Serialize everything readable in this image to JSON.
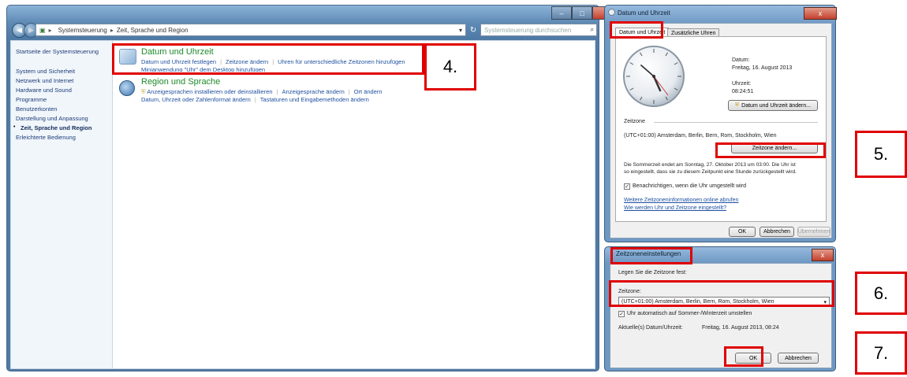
{
  "control_panel": {
    "address": [
      "Systemsteuerung",
      "Zeit, Sprache und Region"
    ],
    "search_placeholder": "Systemsteuerung durchsuchen",
    "sidebar": [
      {
        "label": "Startseite der Systemsteuerung",
        "active": false
      },
      {
        "label": "System und Sicherheit",
        "active": false
      },
      {
        "label": "Netzwerk und Internet",
        "active": false
      },
      {
        "label": "Hardware und Sound",
        "active": false
      },
      {
        "label": "Programme",
        "active": false
      },
      {
        "label": "Benutzerkonten",
        "active": false
      },
      {
        "label": "Darstellung und Anpassung",
        "active": false
      },
      {
        "label": "Zeit, Sprache und Region",
        "active": true
      },
      {
        "label": "Erleichterte Bedienung",
        "active": false
      }
    ],
    "categories": {
      "datetime": {
        "title": "Datum und Uhrzeit",
        "links": [
          "Datum und Uhrzeit festlegen",
          "Zeitzone ändern",
          "Uhren für unterschiedliche Zeitzonen hinzufügen"
        ],
        "link2": "Minianwendung \"Uhr\" dem Desktop hinzufügen"
      },
      "region": {
        "title": "Region und Sprache",
        "links": [
          "Anzeigesprachen installieren oder deinstallieren",
          "Anzeigesprache ändern",
          "Ort ändern"
        ],
        "links2": [
          "Datum, Uhrzeit oder Zahlenformat ändern",
          "Tastaturen und Eingabemethoden ändern"
        ]
      }
    }
  },
  "datetime_dialog": {
    "title": "Datum und Uhrzeit",
    "close": "x",
    "tabs": [
      "Datum und Uhrzeit",
      "Zusätzliche Uhren"
    ],
    "date_label": "Datum:",
    "date_value": "Freitag, 16. August 2013",
    "time_label": "Uhrzeit:",
    "time_value": "08:24:51",
    "change_datetime_button": "Datum und Uhrzeit ändern...",
    "timezone_heading": "Zeitzone",
    "timezone_value": "(UTC+01:00) Amsterdam, Berlin, Bern, Rom, Stockholm, Wien",
    "change_timezone_button": "Zeitzone ändern...",
    "dst_line1": "Die Sommerzeit endet am Sonntag, 27. Oktober 2013 um 03:00. Die Uhr ist",
    "dst_line2": "so eingestellt, dass sie zu diesem Zeitpunkt eine Stunde zurückgestellt wird.",
    "notify_label": "Benachrichtigen, wenn die Uhr umgestellt wird",
    "link_more_info": "Weitere Zeitzoneninformationen online abrufen",
    "link_how_set": "Wie werden Uhr und Zeitzone eingestellt?",
    "ok": "OK",
    "cancel": "Abbrechen",
    "apply": "Übernehmen"
  },
  "timezone_dialog": {
    "title": "Zeitzoneneinstellungen",
    "close": "x",
    "instruction": "Legen Sie die Zeitzone fest:",
    "timezone_label": "Zeitzone:",
    "timezone_selected": "(UTC+01:00) Amsterdam, Berlin, Bern, Rom, Stockholm, Wien",
    "dst_checkbox_label": "Uhr automatisch auf Sommer-/Winterzeit umstellen",
    "current_label": "Aktuelle(s) Datum/Uhrzeit:",
    "current_value": "Freitag, 16. August 2013, 08:24",
    "ok": "OK",
    "cancel": "Abbrechen"
  },
  "steps": [
    "4.",
    "5.",
    "6.",
    "7."
  ],
  "colors": {
    "highlight": "#e00000",
    "category_title": "#1e8a2a",
    "link": "#1d4f9f"
  }
}
